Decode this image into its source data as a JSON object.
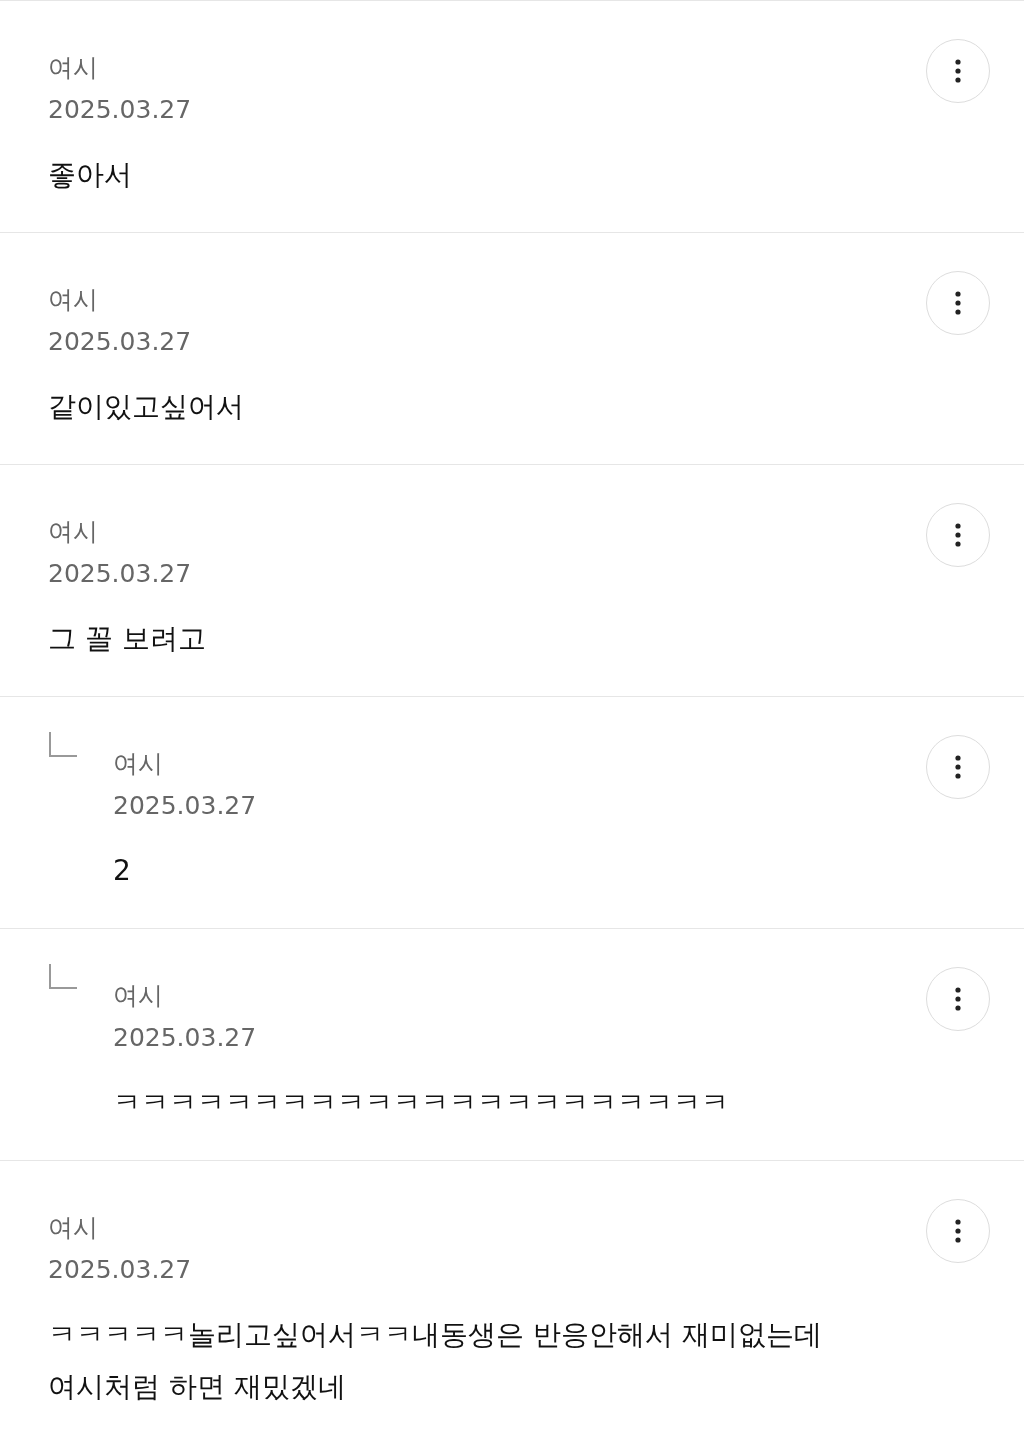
{
  "comments": [
    {
      "kind": "comment",
      "author": "여시",
      "date": "2025.03.27",
      "text": "좋아서"
    },
    {
      "kind": "comment",
      "author": "여시",
      "date": "2025.03.27",
      "text": "같이있고싶어서"
    },
    {
      "kind": "comment",
      "author": "여시",
      "date": "2025.03.27",
      "text": "그 꼴 보려고"
    },
    {
      "kind": "reply",
      "author": "여시",
      "date": "2025.03.27",
      "text": "2"
    },
    {
      "kind": "reply",
      "author": "여시",
      "date": "2025.03.27",
      "text": "ㅋㅋㅋㅋㅋㅋㅋㅋㅋㅋㅋㅋㅋㅋㅋㅋㅋㅋㅋㅋㅋㅋ"
    },
    {
      "kind": "comment",
      "author": "여시",
      "date": "2025.03.27",
      "text": "ㅋㅋㅋㅋㅋ놀리고싶어서ㅋㅋ내동생은 반응안해서 재미없는데 여시처럼 하면 재밌겠네"
    }
  ]
}
